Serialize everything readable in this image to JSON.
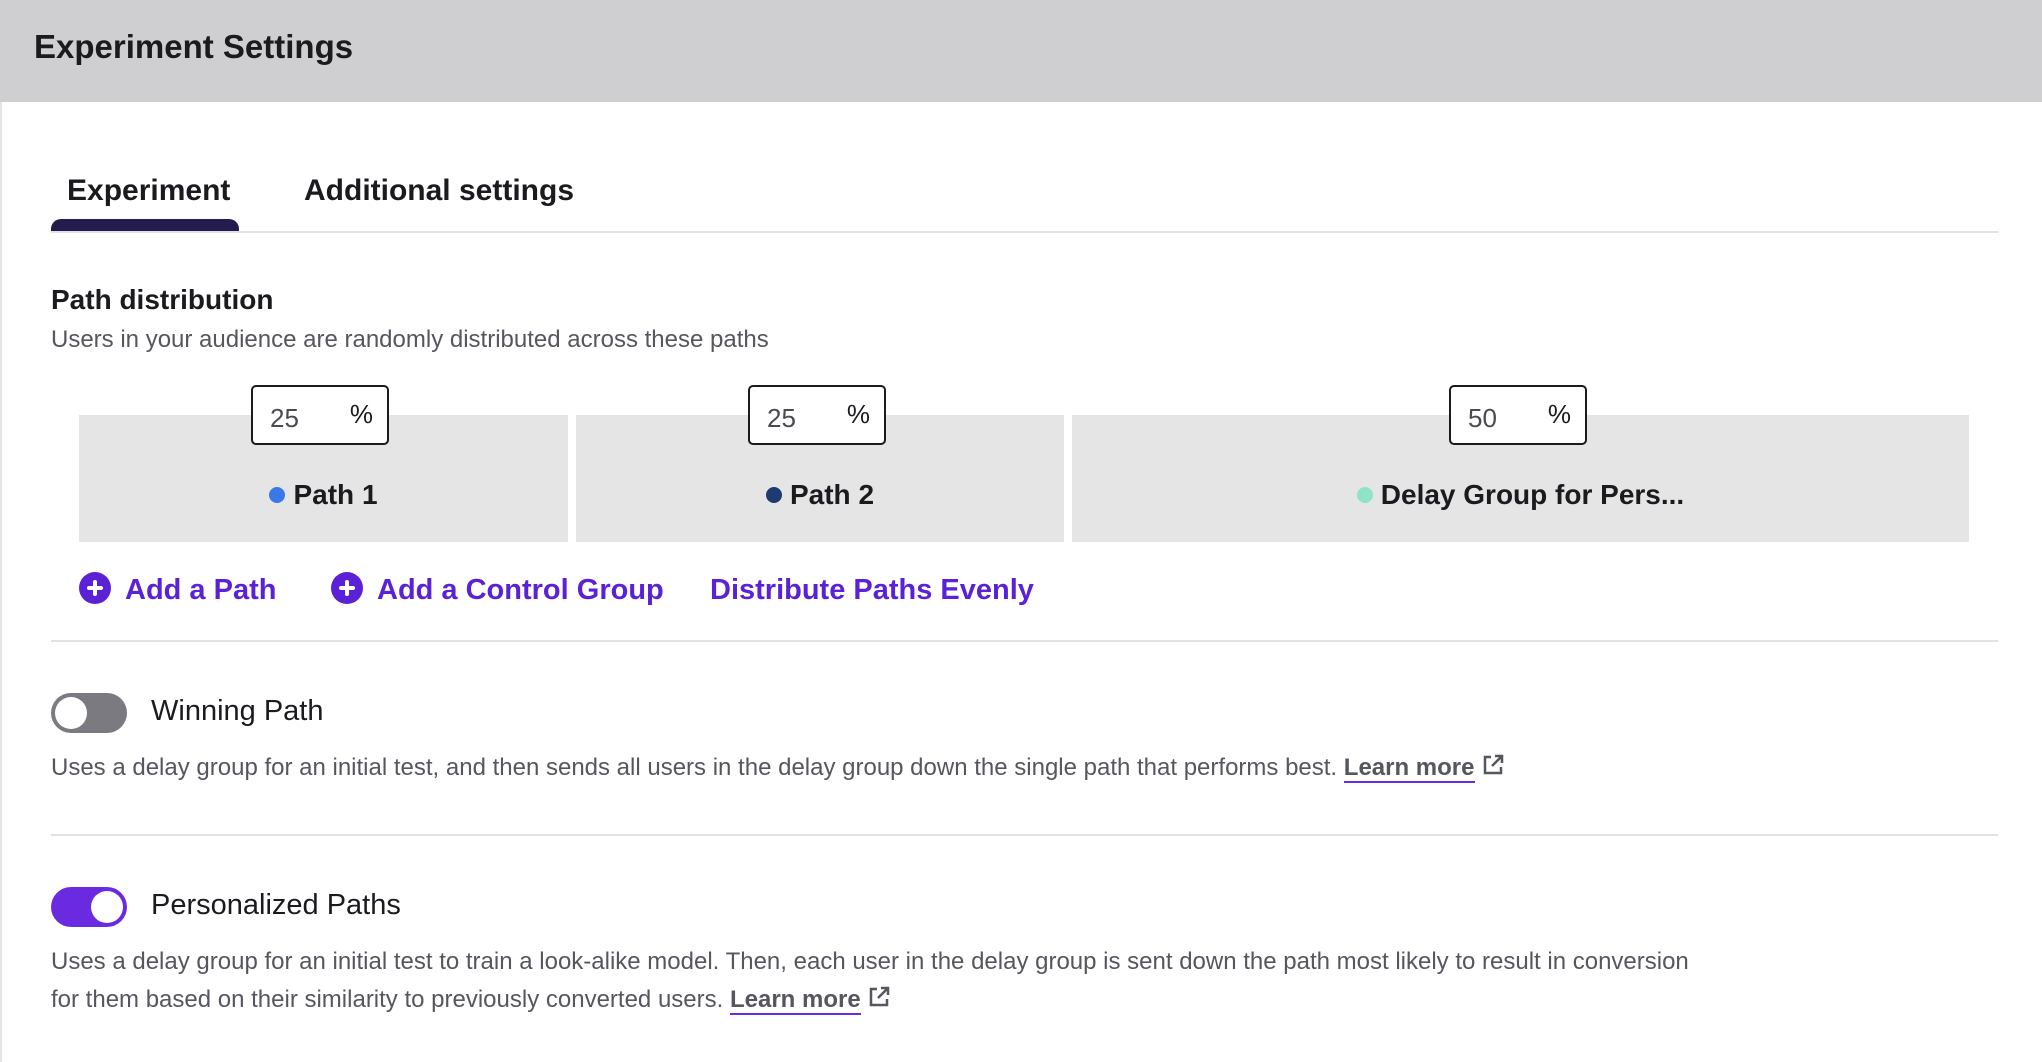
{
  "header": {
    "title": "Experiment Settings"
  },
  "tabs": [
    {
      "label": "Experiment",
      "active": true
    },
    {
      "label": "Additional settings",
      "active": false
    }
  ],
  "path_distribution": {
    "title": "Path distribution",
    "subtitle": "Users in your audience are randomly distributed across these paths",
    "paths": [
      {
        "label": "Path 1",
        "percent": "25",
        "unit": "%",
        "dot_color": "#3b78e7"
      },
      {
        "label": "Path 2",
        "percent": "25",
        "unit": "%",
        "dot_color": "#1e3a6e"
      },
      {
        "label": "Delay Group for Pers...",
        "percent": "50",
        "unit": "%",
        "dot_color": "#8fe3c8"
      }
    ]
  },
  "actions": {
    "add_path": "Add a Path",
    "add_control_group": "Add a Control Group",
    "distribute_evenly": "Distribute Paths Evenly"
  },
  "winning_path": {
    "label": "Winning Path",
    "enabled": false,
    "description": "Uses a delay group for an initial test, and then sends all users in the delay group down the single path that performs best.",
    "learn_more": "Learn more"
  },
  "personalized_paths": {
    "label": "Personalized Paths",
    "enabled": true,
    "description_line1": "Uses a delay group for an initial test to train a look-alike model. Then, each user in the delay group is sent down the path most likely to result in conversion",
    "description_line2": "for them based on their similarity to previously converted users.",
    "learn_more": "Learn more"
  },
  "colors": {
    "accent": "#5b21d6",
    "tab_indicator": "#241c4e",
    "toggle_on": "#6a2be0",
    "toggle_off": "#7a7a80"
  }
}
